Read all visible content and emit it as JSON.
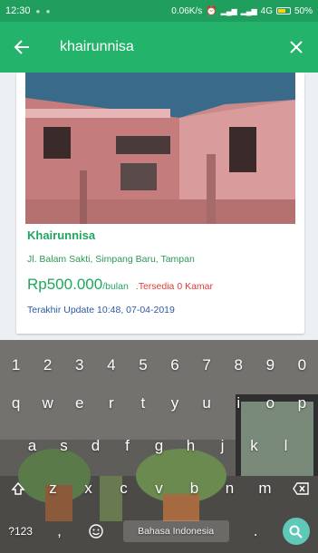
{
  "status_bar": {
    "time": "12:30",
    "network_speed": "0.06K/s",
    "network_type": "4G",
    "battery": "50%"
  },
  "app_bar": {
    "search_value": "khairunnisa"
  },
  "listing": {
    "name": "Khairunnisa",
    "address": "Jl. Balam Sakti, Simpang Baru, Tampan",
    "price": "Rp500.000",
    "price_unit": "/bulan",
    "availability": ".Tersedia 0 Kamar",
    "updated": "Terakhir Update 10:48, 07-04-2019"
  },
  "keyboard": {
    "row_numbers": [
      "1",
      "2",
      "3",
      "4",
      "5",
      "6",
      "7",
      "8",
      "9",
      "0"
    ],
    "row_1": [
      "q",
      "w",
      "e",
      "r",
      "t",
      "y",
      "u",
      "i",
      "o",
      "p"
    ],
    "row_2": [
      "a",
      "s",
      "d",
      "f",
      "g",
      "h",
      "j",
      "k",
      "l"
    ],
    "row_3": [
      "z",
      "x",
      "c",
      "v",
      "b",
      "n",
      "m"
    ],
    "symbols_key": "?123",
    "comma_key": ",",
    "space_label": "Bahasa Indonesia",
    "period_key": "."
  }
}
